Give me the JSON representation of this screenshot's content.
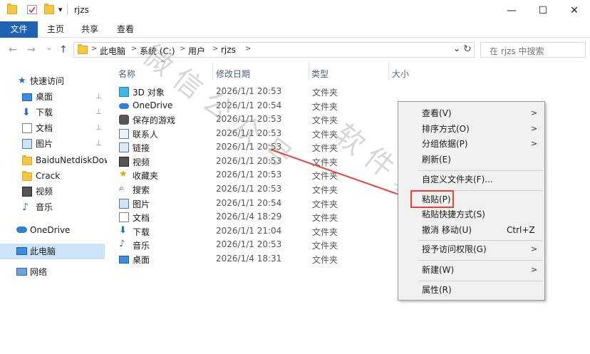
{
  "window": {
    "title": "rjzs"
  },
  "titlebar": {
    "minimize": "—",
    "maximize": "☐",
    "close": "✕",
    "qat_arrow": "▾"
  },
  "ribbon": {
    "tabs": [
      "文件",
      "主页",
      "共享",
      "查看"
    ]
  },
  "nav": {
    "back": "←",
    "forward": "→",
    "recent": "⌄",
    "up": "↑"
  },
  "address": {
    "crumbs": [
      "此电脑",
      "系统 (C:)",
      "用户",
      "rjzs"
    ],
    "separator": ">",
    "dropdown": "⌄",
    "refresh": "↻"
  },
  "search": {
    "placeholder": "在 rjzs 中搜索",
    "icon": "🔍"
  },
  "sidebar": {
    "quick_access": "快速访问",
    "items": [
      {
        "label": "桌面",
        "icon": "desktop-icon",
        "pinned": true
      },
      {
        "label": "下载",
        "icon": "download-icon",
        "pinned": true
      },
      {
        "label": "文档",
        "icon": "documents-icon",
        "pinned": true
      },
      {
        "label": "图片",
        "icon": "pictures-icon",
        "pinned": true
      },
      {
        "label": "BaiduNetdiskDow",
        "icon": "folder-icon",
        "pinned": false
      },
      {
        "label": "Crack",
        "icon": "folder-icon",
        "pinned": false
      },
      {
        "label": "视频",
        "icon": "videos-icon",
        "pinned": false
      },
      {
        "label": "音乐",
        "icon": "music-icon",
        "pinned": false
      }
    ],
    "onedrive": "OneDrive",
    "this_pc": "此电脑",
    "network": "网络",
    "pin_glyph": "📌"
  },
  "columns": {
    "name": "名称",
    "date": "修改日期",
    "type": "类型",
    "size": "大小"
  },
  "files": [
    {
      "name": "3D 对象",
      "date": "2026/1/1 20:53",
      "type": "文件夹",
      "icon": "3d-objects-icon"
    },
    {
      "name": "OneDrive",
      "date": "2026/1/1 20:54",
      "type": "文件夹",
      "icon": "onedrive-icon"
    },
    {
      "name": "保存的游戏",
      "date": "2026/1/1 20:53",
      "type": "文件夹",
      "icon": "saved-games-icon"
    },
    {
      "name": "联系人",
      "date": "2026/1/1 20:53",
      "type": "文件夹",
      "icon": "contacts-icon"
    },
    {
      "name": "链接",
      "date": "2026/1/1 20:53",
      "type": "文件夹",
      "icon": "links-icon"
    },
    {
      "name": "视频",
      "date": "2026/1/1 20:53",
      "type": "文件夹",
      "icon": "videos-icon"
    },
    {
      "name": "收藏夹",
      "date": "2026/1/1 20:53",
      "type": "文件夹",
      "icon": "favorites-icon"
    },
    {
      "name": "搜索",
      "date": "2026/1/1 20:53",
      "type": "文件夹",
      "icon": "searches-icon"
    },
    {
      "name": "图片",
      "date": "2026/1/1 20:54",
      "type": "文件夹",
      "icon": "pictures-icon"
    },
    {
      "name": "文档",
      "date": "2026/1/4 18:29",
      "type": "文件夹",
      "icon": "documents-icon"
    },
    {
      "name": "下载",
      "date": "2026/1/1 21:04",
      "type": "文件夹",
      "icon": "download-icon"
    },
    {
      "name": "音乐",
      "date": "2026/1/1 20:53",
      "type": "文件夹",
      "icon": "music-icon"
    },
    {
      "name": "桌面",
      "date": "2026/1/4 18:31",
      "type": "文件夹",
      "icon": "desktop-icon"
    }
  ],
  "context_menu": {
    "view": "查看(V)",
    "sort": "排序方式(O)",
    "group": "分组依据(P)",
    "refresh": "刷新(E)",
    "customize": "自定义文件夹(F)...",
    "paste": "粘贴(P)",
    "paste_shortcut": "粘贴快捷方式(S)",
    "undo_move": "撤消 移动(U)",
    "undo_shortcut": "Ctrl+Z",
    "grant_access": "授予访问权限(G)",
    "new": "新建(W)",
    "properties": "属性(R)",
    "submenu_arrow": ">"
  },
  "colors": {
    "accent": "#1f63b4",
    "highlight": "#e8423d",
    "selected_bg": "#cce4f7"
  }
}
